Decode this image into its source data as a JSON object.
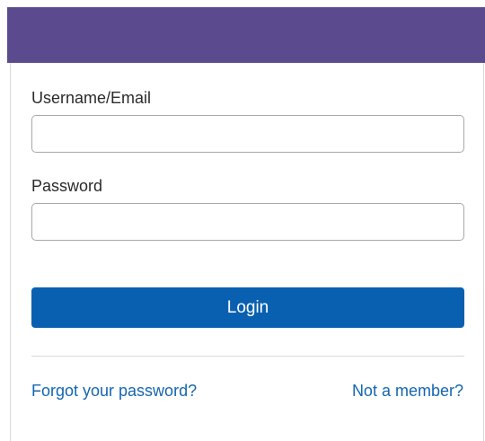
{
  "form": {
    "username_label": "Username/Email",
    "username_value": "",
    "password_label": "Password",
    "password_value": "",
    "login_label": "Login",
    "forgot_link": "Forgot your password?",
    "member_link": "Not a member?"
  },
  "colors": {
    "header": "#5b4b8e",
    "primary_button": "#0a60b0",
    "link": "#1466b0"
  }
}
